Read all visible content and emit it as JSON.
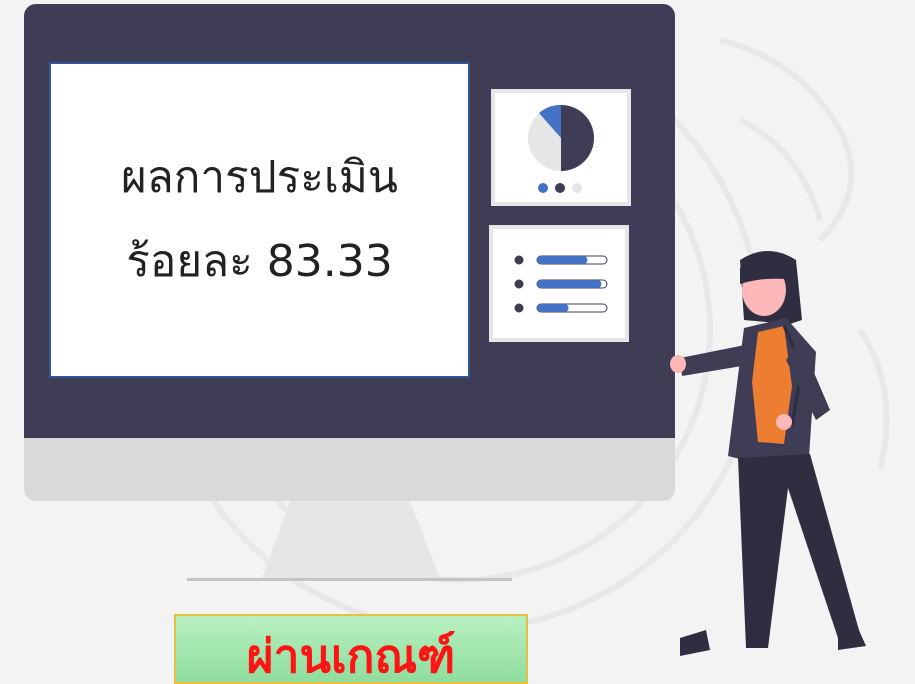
{
  "result": {
    "line1": "ผลการประเมิน",
    "line2": "ร้อยละ 83.33"
  },
  "cta": {
    "label": "ผ่านเกณฑ์"
  },
  "widgets": {
    "pie_icon": "pie-chart-icon",
    "list_icon": "bulleted-list-icon",
    "list_levels": [
      0.72,
      0.92,
      0.45
    ]
  },
  "colors": {
    "monitor": "#3f3d56",
    "accent_blue": "#4472c4",
    "shirt": "#ed7d31",
    "cta_bg": "#9be3a8",
    "cta_text": "#ff1414"
  }
}
